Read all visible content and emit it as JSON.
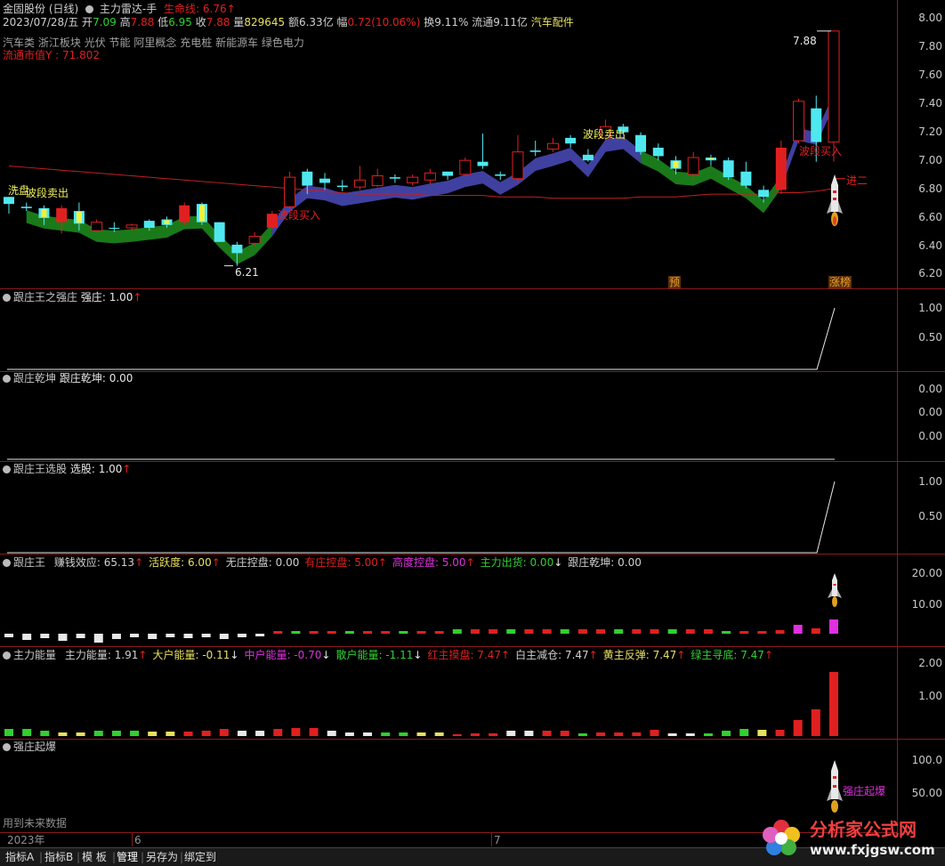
{
  "header": {
    "stock_name": "金固股份",
    "period": "(日线)",
    "indicator_name": "主力雷达-手",
    "lifeline_label": "生命线",
    "lifeline_value": "6.76",
    "date": "2023/07/28/五",
    "open_label": "开",
    "open": "7.09",
    "high_label": "高",
    "high": "7.88",
    "low_label": "低",
    "low": "6.95",
    "close_label": "收",
    "close": "7.88",
    "volume_label": "量",
    "volume": "829645",
    "amount_label": "额",
    "amount": "6.33亿",
    "change_label": "幅",
    "change": "0.72(10.06%)",
    "turnover_label": "换",
    "turnover": "9.11%",
    "float_label": "流通",
    "float": "9.11亿",
    "sector": "汽车配件",
    "concepts": [
      "汽车类",
      "浙江板块",
      "光伏",
      "节能",
      "阿里概念",
      "充电桩",
      "新能源车",
      "绿色电力"
    ],
    "float_mcap": "流通市值Y : 71.802"
  },
  "main_chart": {
    "y_ticks": [
      "8.00",
      "7.80",
      "7.60",
      "7.40",
      "7.20",
      "7.00",
      "6.80",
      "6.60",
      "6.40",
      "6.20"
    ],
    "labels": {
      "xipan": "洗盘",
      "wave_sell_1": "波段卖出",
      "wave_buy_1": "波段买入",
      "wave_sell_2": "波段卖出",
      "wave_buy_2": "波段买入",
      "jin_er": "进二",
      "yu": "预",
      "zhangting": "涨榜",
      "high_mark": "7.88",
      "low_mark": "6.21"
    }
  },
  "chart_data": {
    "type": "candlestick",
    "ylim": [
      6.1,
      8.05
    ],
    "candles": [
      {
        "o": 6.65,
        "h": 6.7,
        "l": 6.58,
        "c": 6.7,
        "up": false
      },
      {
        "o": 6.63,
        "h": 6.66,
        "l": 6.6,
        "c": 6.62,
        "up": false
      },
      {
        "o": 6.62,
        "h": 6.64,
        "l": 6.5,
        "c": 6.55,
        "up": false,
        "y": true
      },
      {
        "o": 6.62,
        "h": 6.64,
        "l": 6.44,
        "c": 6.52,
        "up": true,
        "r": true
      },
      {
        "o": 6.6,
        "h": 6.66,
        "l": 6.46,
        "c": 6.51,
        "up": false,
        "y": true
      },
      {
        "o": 6.46,
        "h": 6.54,
        "l": 6.45,
        "c": 6.52,
        "up": true
      },
      {
        "o": 6.48,
        "h": 6.52,
        "l": 6.45,
        "c": 6.48,
        "up": false
      },
      {
        "o": 6.48,
        "h": 6.51,
        "l": 6.46,
        "c": 6.5,
        "up": true
      },
      {
        "o": 6.53,
        "h": 6.54,
        "l": 6.46,
        "c": 6.48,
        "up": false
      },
      {
        "o": 6.5,
        "h": 6.56,
        "l": 6.48,
        "c": 6.54,
        "up": false,
        "y": true
      },
      {
        "o": 6.52,
        "h": 6.66,
        "l": 6.5,
        "c": 6.64,
        "up": true,
        "r": true
      },
      {
        "o": 6.65,
        "h": 6.66,
        "l": 6.5,
        "c": 6.52,
        "up": false,
        "y": true
      },
      {
        "o": 6.52,
        "h": 6.52,
        "l": 6.38,
        "c": 6.38,
        "up": false
      },
      {
        "o": 6.36,
        "h": 6.38,
        "l": 6.21,
        "c": 6.3,
        "up": false
      },
      {
        "o": 6.37,
        "h": 6.45,
        "l": 6.35,
        "c": 6.42,
        "up": true
      },
      {
        "o": 6.48,
        "h": 6.6,
        "l": 6.47,
        "c": 6.58,
        "up": true,
        "r": true
      },
      {
        "o": 6.63,
        "h": 6.88,
        "l": 6.6,
        "c": 6.84,
        "up": true
      },
      {
        "o": 6.78,
        "h": 6.9,
        "l": 6.72,
        "c": 6.88,
        "up": false
      },
      {
        "o": 6.83,
        "h": 6.87,
        "l": 6.75,
        "c": 6.8,
        "up": false
      },
      {
        "o": 6.78,
        "h": 6.82,
        "l": 6.74,
        "c": 6.77,
        "up": false
      },
      {
        "o": 6.77,
        "h": 6.92,
        "l": 6.75,
        "c": 6.82,
        "up": true
      },
      {
        "o": 6.78,
        "h": 6.9,
        "l": 6.77,
        "c": 6.85,
        "up": true
      },
      {
        "o": 6.83,
        "h": 6.86,
        "l": 6.8,
        "c": 6.84,
        "up": false
      },
      {
        "o": 6.8,
        "h": 6.86,
        "l": 6.78,
        "c": 6.84,
        "up": true
      },
      {
        "o": 6.82,
        "h": 6.9,
        "l": 6.79,
        "c": 6.87,
        "up": true
      },
      {
        "o": 6.85,
        "h": 6.88,
        "l": 6.82,
        "c": 6.88,
        "up": false
      },
      {
        "o": 6.86,
        "h": 6.98,
        "l": 6.85,
        "c": 6.96,
        "up": true
      },
      {
        "o": 6.92,
        "h": 7.15,
        "l": 6.9,
        "c": 6.95,
        "up": false
      },
      {
        "o": 6.85,
        "h": 6.88,
        "l": 6.82,
        "c": 6.86,
        "up": false
      },
      {
        "o": 6.83,
        "h": 7.14,
        "l": 6.8,
        "c": 7.02,
        "up": true
      },
      {
        "o": 7.02,
        "h": 7.1,
        "l": 6.99,
        "c": 7.03,
        "up": false
      },
      {
        "o": 7.04,
        "h": 7.12,
        "l": 7.02,
        "c": 7.08,
        "up": true
      },
      {
        "o": 7.12,
        "h": 7.14,
        "l": 7.05,
        "c": 7.08,
        "up": false
      },
      {
        "o": 7.0,
        "h": 7.04,
        "l": 6.95,
        "c": 6.96,
        "up": false
      },
      {
        "o": 7.2,
        "h": 7.25,
        "l": 7.1,
        "c": 7.12,
        "up": true
      },
      {
        "o": 7.2,
        "h": 7.22,
        "l": 7.14,
        "c": 7.16,
        "up": false
      },
      {
        "o": 7.14,
        "h": 7.16,
        "l": 7.0,
        "c": 7.02,
        "up": false
      },
      {
        "o": 7.05,
        "h": 7.08,
        "l": 6.96,
        "c": 6.99,
        "up": false
      },
      {
        "o": 6.96,
        "h": 6.99,
        "l": 6.86,
        "c": 6.9,
        "up": false,
        "y": true
      },
      {
        "o": 6.98,
        "h": 7.02,
        "l": 6.82,
        "c": 6.86,
        "up": true
      },
      {
        "o": 6.98,
        "h": 7.0,
        "l": 6.92,
        "c": 6.96,
        "up": false,
        "y": true
      },
      {
        "o": 6.96,
        "h": 6.98,
        "l": 6.82,
        "c": 6.84,
        "up": false
      },
      {
        "o": 6.88,
        "h": 6.95,
        "l": 6.76,
        "c": 6.78,
        "up": false
      },
      {
        "o": 6.75,
        "h": 6.78,
        "l": 6.66,
        "c": 6.7,
        "up": false
      },
      {
        "o": 6.75,
        "h": 7.1,
        "l": 6.72,
        "c": 7.05,
        "up": true,
        "r": true
      },
      {
        "o": 7.1,
        "h": 7.4,
        "l": 7.08,
        "c": 7.38,
        "up": true
      },
      {
        "o": 7.09,
        "h": 7.42,
        "l": 6.95,
        "c": 7.33,
        "up": false
      },
      {
        "o": 7.09,
        "h": 7.88,
        "l": 6.95,
        "c": 7.88,
        "up": true
      }
    ],
    "ma_life": [
      6.92,
      6.91,
      6.9,
      6.89,
      6.88,
      6.87,
      6.86,
      6.85,
      6.84,
      6.83,
      6.82,
      6.81,
      6.8,
      6.79,
      6.78,
      6.77,
      6.76,
      6.75,
      6.74,
      6.73,
      6.72,
      6.72,
      6.72,
      6.72,
      6.71,
      6.71,
      6.71,
      6.71,
      6.7,
      6.7,
      6.7,
      6.69,
      6.69,
      6.69,
      6.69,
      6.69,
      6.7,
      6.7,
      6.7,
      6.71,
      6.72,
      6.72,
      6.72,
      6.72,
      6.73,
      6.73,
      6.74,
      6.76
    ]
  },
  "panel1": {
    "name": "跟庄王之强庄",
    "label": "强庄: ",
    "value": "1.00",
    "ticks": [
      "1.00",
      "0.50"
    ]
  },
  "panel2": {
    "name": "跟庄乾坤",
    "label": "跟庄乾坤: ",
    "value": "0.00",
    "ticks": [
      "0.00",
      "0.00",
      "0.00"
    ]
  },
  "panel3": {
    "name": "跟庄王选股",
    "label": "选股: ",
    "value": "1.00",
    "ticks": [
      "1.00",
      "0.50"
    ]
  },
  "panel4": {
    "name": "跟庄王",
    "items": [
      {
        "label": "赚钱效应: ",
        "value": "65.13",
        "color": "#d0d0d0",
        "arrow": "up"
      },
      {
        "label": "活跃度: ",
        "value": "6.00",
        "color": "#e8e060",
        "arrow": "up"
      },
      {
        "label": "无庄控盘: ",
        "value": "0.00",
        "color": "#d0d0d0",
        "arrow": ""
      },
      {
        "label": "有庄控盘: ",
        "value": "5.00",
        "color": "#e02020",
        "arrow": "up"
      },
      {
        "label": "高度控盘: ",
        "value": "5.00",
        "color": "#e030e0",
        "arrow": "up"
      },
      {
        "label": "主力出货: ",
        "value": "0.00",
        "color": "#30d030",
        "arrow": "down"
      },
      {
        "label": "跟庄乾坤: ",
        "value": "0.00",
        "color": "#d0d0d0",
        "arrow": ""
      }
    ],
    "ticks": [
      "20.00",
      "10.00"
    ]
  },
  "panel5": {
    "name": "主力能量",
    "items": [
      {
        "label": "主力能量: ",
        "value": "1.91",
        "color": "#d0d0d0",
        "arrow": "up"
      },
      {
        "label": "大户能量: ",
        "value": "-0.11",
        "color": "#e8e060",
        "arrow": "down"
      },
      {
        "label": "中户能量: ",
        "value": "-0.70",
        "color": "#e030e0",
        "arrow": "down"
      },
      {
        "label": "散户能量: ",
        "value": "-1.11",
        "color": "#30d030",
        "arrow": "down"
      },
      {
        "label": "红主摸盘: ",
        "value": "7.47",
        "color": "#e02020",
        "arrow": "up"
      },
      {
        "label": "白主减仓: ",
        "value": "7.47",
        "color": "#d0d0d0",
        "arrow": "up"
      },
      {
        "label": "黄主反弹: ",
        "value": "7.47",
        "color": "#e8e060",
        "arrow": "up"
      },
      {
        "label": "绿主寻底: ",
        "value": "7.47",
        "color": "#30d030",
        "arrow": "up"
      }
    ],
    "ticks": [
      "2.00",
      "1.00"
    ]
  },
  "panel6": {
    "name": "强庄起爆",
    "label_qibao": "强庄起爆",
    "ticks": [
      "100.0",
      "50.00"
    ]
  },
  "future_data": "用到未来数据",
  "timeline": [
    "2023年",
    "6",
    "7"
  ],
  "toolbar": [
    "指标A",
    "指标B",
    "模 板",
    "管理",
    "另存为",
    "绑定到"
  ],
  "watermark": {
    "cn": "分析家公式网",
    "url": "www.fxjgsw.com"
  },
  "colors": {
    "up": "#e02020",
    "down": "#50e8f0",
    "grid": "#8a1a1a"
  }
}
